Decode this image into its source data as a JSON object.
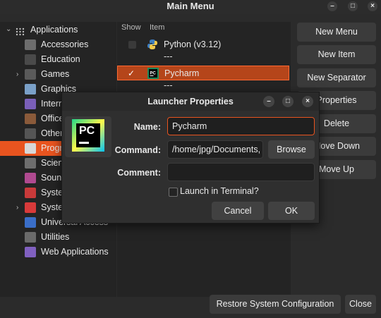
{
  "window": {
    "title": "Main Menu",
    "minimize_glyph": "–",
    "maximize_glyph": "□",
    "close_glyph": "×"
  },
  "tree": {
    "root_label": "Applications",
    "items": [
      {
        "label": "Accessories",
        "icon": "accessories-icon",
        "color": "#6d6d6d"
      },
      {
        "label": "Education",
        "icon": "education-icon",
        "color": "#4a4a4a"
      },
      {
        "label": "Games",
        "icon": "games-icon",
        "color": "#5a5a5a"
      },
      {
        "label": "Graphics",
        "icon": "graphics-icon",
        "color": "#7aa0c8"
      },
      {
        "label": "Internet",
        "icon": "internet-icon",
        "color": "#7a5fb8"
      },
      {
        "label": "Office",
        "icon": "office-icon",
        "color": "#8a5a3a"
      },
      {
        "label": "Other",
        "icon": "other-icon",
        "color": "#555555"
      },
      {
        "label": "Programming",
        "icon": "programming-icon",
        "color": "#d8d8d8"
      },
      {
        "label": "Science",
        "icon": "science-icon",
        "color": "#6e6e6e"
      },
      {
        "label": "Sound & Video",
        "icon": "sound-video-icon",
        "color": "#b04a90"
      },
      {
        "label": "System Tools",
        "icon": "system-tools-icon",
        "color": "#c83a3a"
      },
      {
        "label": "System Settings",
        "icon": "system-settings-icon",
        "color": "#d83a3a"
      },
      {
        "label": "Universal Access",
        "icon": "universal-access-icon",
        "color": "#3a6ec8"
      },
      {
        "label": "Utilities",
        "icon": "utilities-icon",
        "color": "#6a6a6a"
      },
      {
        "label": "Web Applications",
        "icon": "web-applications-icon",
        "color": "#8060c0"
      }
    ]
  },
  "list": {
    "col_show": "Show",
    "col_item": "Item",
    "rows": [
      {
        "label": "Python (v3.12)",
        "checked": false,
        "icon": "python-icon"
      },
      {
        "label": "---",
        "checked": false,
        "icon": ""
      },
      {
        "label": "Pycharm",
        "checked": true,
        "icon": "pycharm-icon"
      },
      {
        "label": "---",
        "checked": false,
        "icon": ""
      }
    ]
  },
  "buttons": {
    "new_menu": "New Menu",
    "new_item": "New Item",
    "new_separator": "New Separator",
    "properties": "Properties",
    "delete": "Delete",
    "move_down": "Move Down",
    "move_up": "Move Up",
    "restore": "Restore System Configuration",
    "close": "Close"
  },
  "dialog": {
    "title": "Launcher Properties",
    "name_label": "Name:",
    "name_value": "Pycharm",
    "command_label": "Command:",
    "command_value": "/home/jpg/Documents,",
    "browse": "Browse",
    "comment_label": "Comment:",
    "comment_value": "",
    "launch_terminal": "Launch in Terminal?",
    "cancel": "Cancel",
    "ok": "OK",
    "icon_text": "PC"
  },
  "colors": {
    "accent": "#e9541f",
    "selection_dark": "#b5451a"
  }
}
